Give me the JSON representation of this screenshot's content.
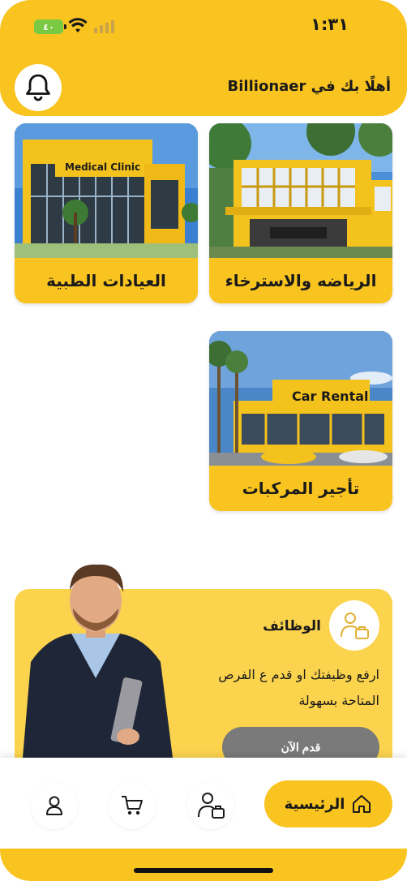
{
  "status": {
    "time": "١:٣١",
    "battery": "٤٠"
  },
  "header": {
    "greeting": "أهلًا بك في Billionaer"
  },
  "categories": [
    {
      "label": "الرياضه والاسترخاء",
      "icon": "sports-building-photo"
    },
    {
      "label": "العيادات الطبية",
      "icon": "medical-clinic-photo",
      "sign": "Medical Clinic"
    },
    {
      "label": "تأجير المركبات",
      "icon": "car-rental-photo",
      "sign": "Car Rental"
    }
  ],
  "jobs": {
    "title": "الوظائف",
    "description": "ارفع وظيفتك او قدم ع الفرص المتاحة بسهولة",
    "apply_label": "قدم الآن"
  },
  "nav": {
    "home_label": "الرئيسية",
    "items": [
      "home",
      "jobs",
      "cart",
      "profile"
    ]
  },
  "colors": {
    "accent": "#f9c320",
    "banner": "#fcd34d",
    "button": "#7a7a7a"
  }
}
